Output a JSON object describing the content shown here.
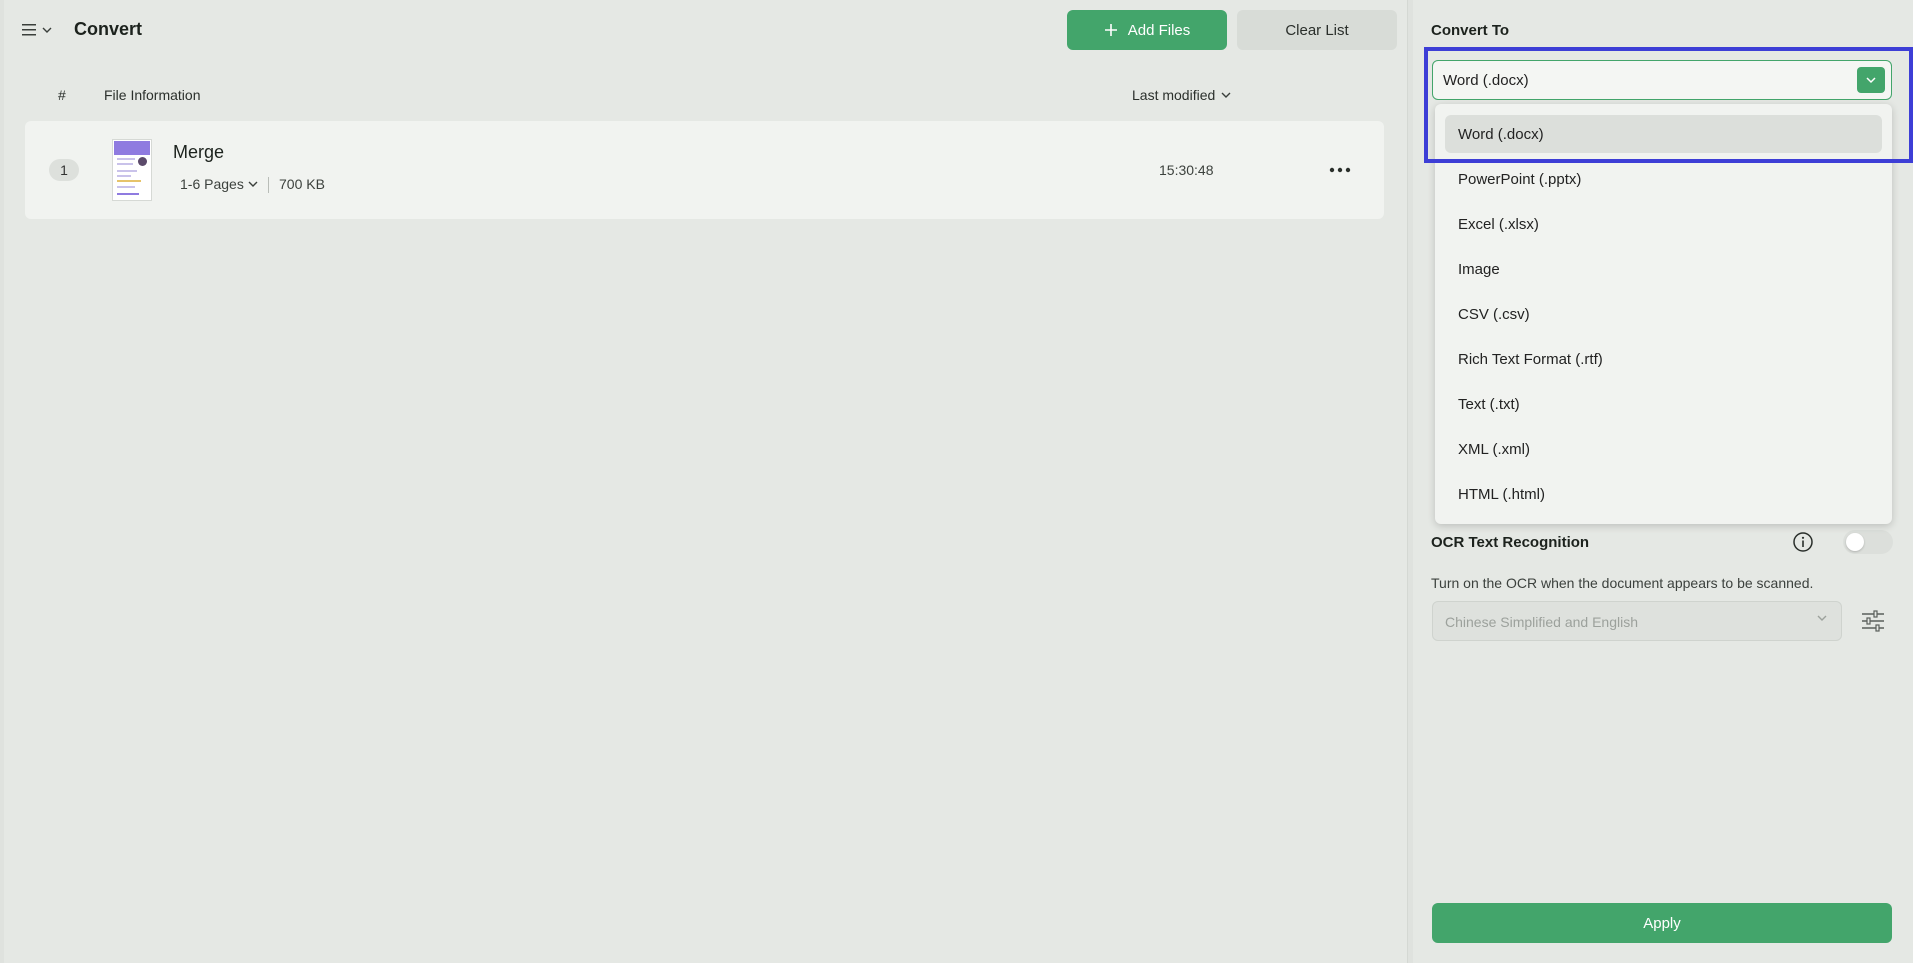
{
  "header": {
    "title": "Convert",
    "add_files_label": "Add Files",
    "clear_list_label": "Clear List"
  },
  "list": {
    "col_index": "#",
    "col_info": "File Information",
    "sort_label": "Last modified",
    "files": [
      {
        "index": "1",
        "name": "Merge",
        "pages": "1-6 Pages",
        "size": "700 KB",
        "time": "15:30:48"
      }
    ]
  },
  "side": {
    "convert_to_label": "Convert To",
    "selected_format": "Word (.docx)",
    "options": [
      "Word (.docx)",
      "PowerPoint (.pptx)",
      "Excel (.xlsx)",
      "Image",
      "CSV (.csv)",
      "Rich Text Format (.rtf)",
      "Text (.txt)",
      "XML (.xml)",
      "HTML (.html)"
    ],
    "ocr_label": "OCR Text Recognition",
    "ocr_enabled": false,
    "ocr_desc": "Turn on the OCR when the document appears to be scanned.",
    "ocr_language": "Chinese Simplified and English",
    "apply_label": "Apply"
  },
  "colors": {
    "accent": "#43a56b",
    "highlight": "#3d3ed6",
    "thumbnail_band": "#8f7be0"
  },
  "icons": {
    "menu": "hamburger-icon",
    "add": "plus-icon",
    "sort": "chevron-down-icon",
    "more": "more-horizontal-icon",
    "info": "info-icon",
    "adjust": "sliders-icon"
  }
}
